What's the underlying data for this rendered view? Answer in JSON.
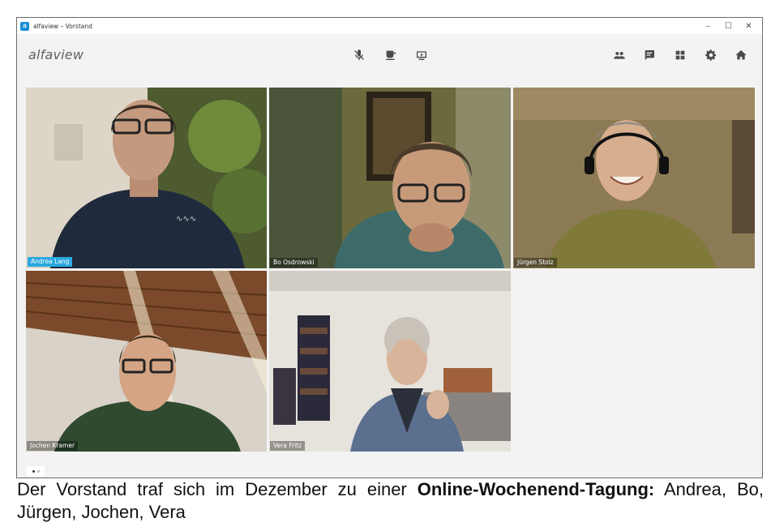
{
  "window": {
    "title": "alfaview – Vorstand",
    "controls": [
      "–",
      "☐",
      "✕"
    ]
  },
  "toolbar": {
    "brand": "alfaview",
    "center_icons": [
      "microphone-muted-icon",
      "coffee-break-icon",
      "screen-share-icon"
    ],
    "right_icons": [
      "participants-icon",
      "chat-icon",
      "layout-grid-icon",
      "settings-gear-icon",
      "home-icon"
    ]
  },
  "participants": [
    {
      "name": "Andrea Lang",
      "active": true
    },
    {
      "name": "Bo Osdrowski",
      "active": false
    },
    {
      "name": "Jürgen Stolz",
      "active": false
    },
    {
      "name": "Jochen Kramer",
      "active": false
    },
    {
      "name": "Vera Fritz",
      "active": false
    }
  ],
  "accent_color": "#2aa9e0",
  "caption": {
    "text_before": "Der Vorstand traf sich im Dezember zu einer ",
    "bold": "Online-Wochenend-Tagung:",
    "text_after": " Andrea, Bo, Jürgen, Jochen, Vera"
  }
}
